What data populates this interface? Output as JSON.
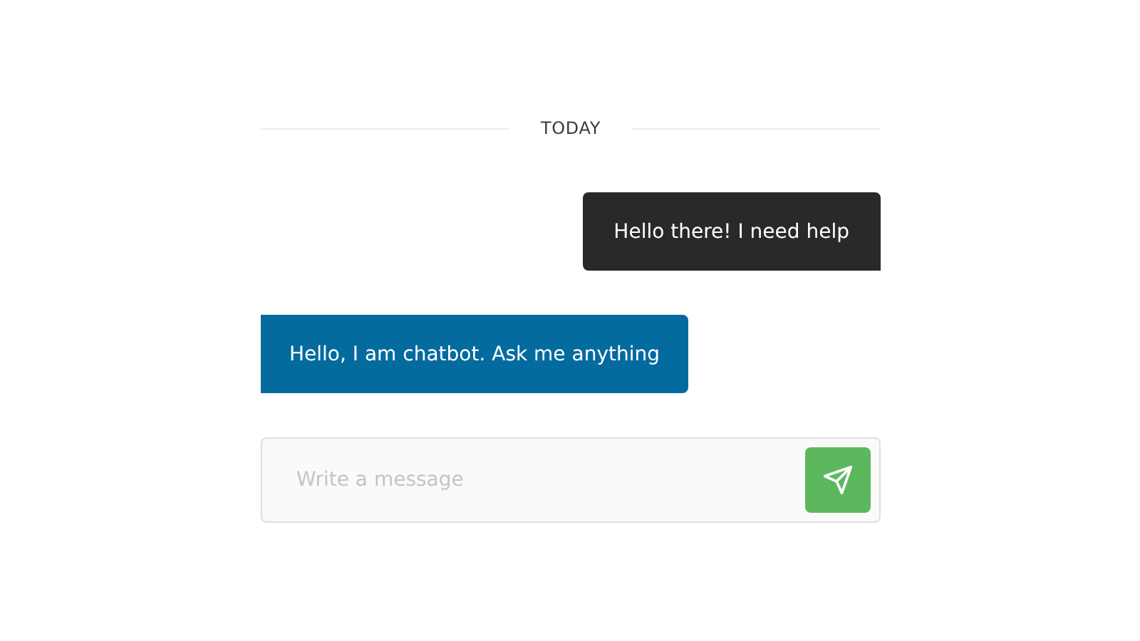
{
  "date_divider": "TODAY",
  "messages": [
    {
      "kind": "user",
      "text": "Hello there! I need help"
    },
    {
      "kind": "bot",
      "text": "Hello, I am chatbot. Ask me anything"
    }
  ],
  "composer": {
    "placeholder": "Write a message"
  }
}
